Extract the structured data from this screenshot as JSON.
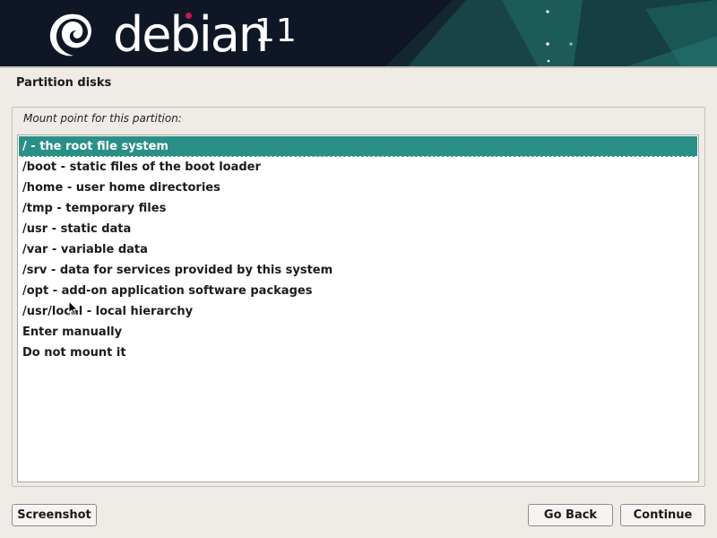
{
  "banner": {
    "brand": "debian",
    "version": "11",
    "colors": {
      "background": "#0f1727",
      "accent_teal": "#1c5f5a",
      "logo_dot": "#c8174f"
    },
    "icons": [
      "debian-swirl-icon"
    ]
  },
  "step": {
    "title": "Partition disks"
  },
  "prompt": {
    "label": "Mount point for this partition:"
  },
  "mount_points": {
    "selected_index": 0,
    "items": [
      {
        "label": "/ - the root file system"
      },
      {
        "label": "/boot - static files of the boot loader"
      },
      {
        "label": "/home - user home directories"
      },
      {
        "label": "/tmp - temporary files"
      },
      {
        "label": "/usr - static data"
      },
      {
        "label": "/var - variable data"
      },
      {
        "label": "/srv - data for services provided by this system"
      },
      {
        "label": "/opt - add-on application software packages"
      },
      {
        "label": "/usr/local - local hierarchy"
      },
      {
        "label": "Enter manually"
      },
      {
        "label": "Do not mount it"
      }
    ],
    "selection_color": "#2a8f86"
  },
  "buttons": {
    "screenshot": "Screenshot",
    "back": "Go Back",
    "continue": "Continue"
  }
}
